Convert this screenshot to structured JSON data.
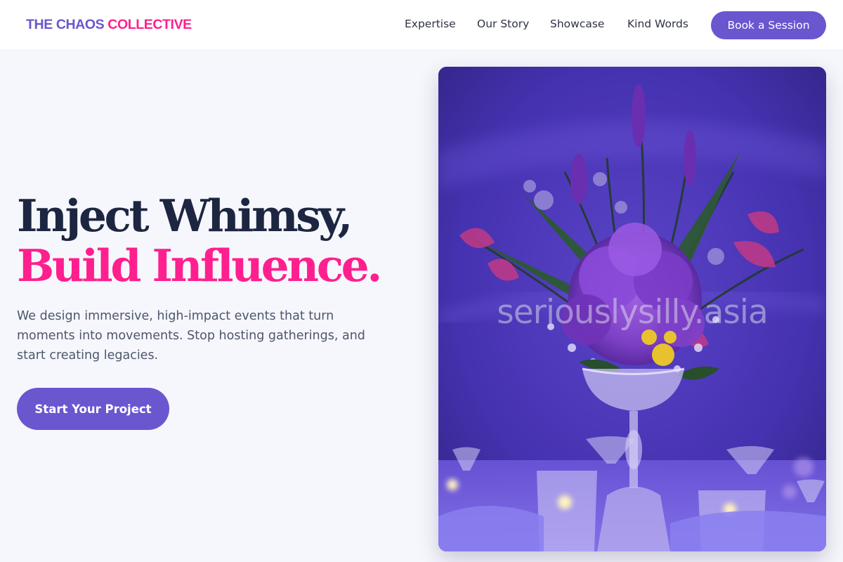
{
  "header": {
    "brand_part1": "THE CHAOS",
    "brand_part2": "COLLECTIVE",
    "nav": [
      "Expertise",
      "Our Story",
      "Showcase",
      "Kind Words"
    ],
    "cta": "Book a Session"
  },
  "hero": {
    "headline_line1": "Inject Whimsy,",
    "headline_line2": "Build Influence.",
    "description": "We design immersive, high-impact events that turn moments into movements. Stop hosting gatherings, and start creating legacies.",
    "cta": "Start Your Project",
    "image_watermark": "seriouslysilly.asia"
  },
  "colors": {
    "brand_purple": "#6a56cf",
    "brand_pink": "#ff1f8e",
    "headline_dark": "#1d2641",
    "page_background": "#f6f7fc"
  },
  "icons": {
    "hero_image": "purple-floral-centerpiece-photo"
  }
}
